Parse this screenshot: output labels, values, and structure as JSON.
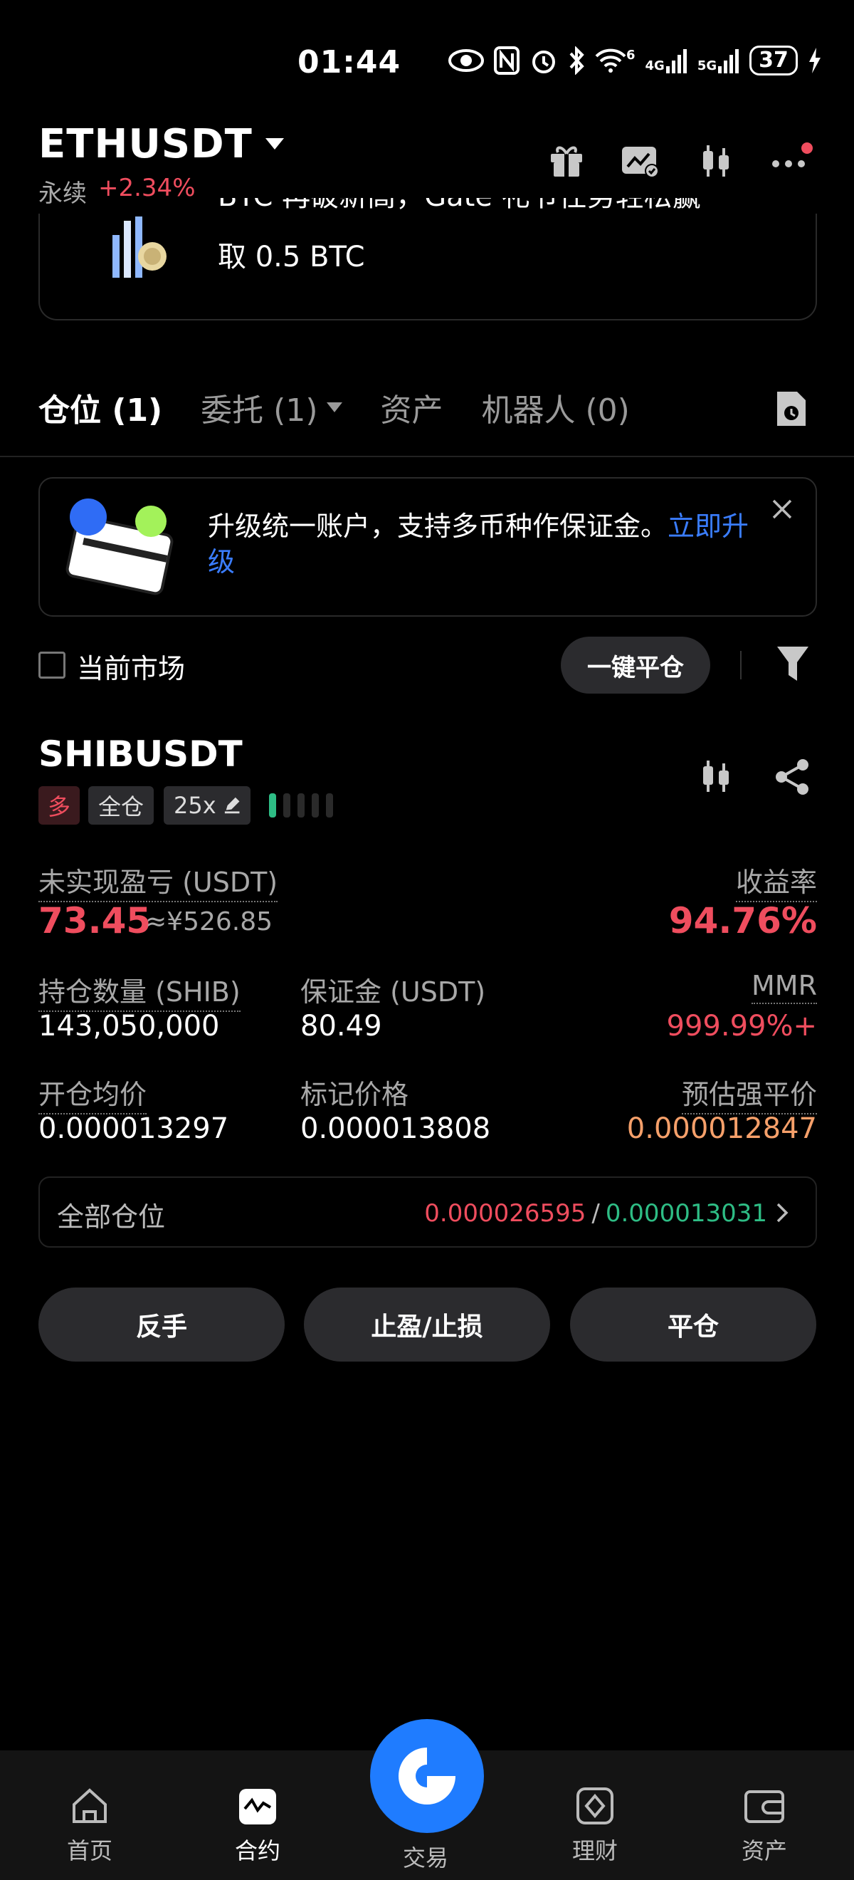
{
  "status_bar": {
    "time": "01:44",
    "battery": "37",
    "net1": "4G",
    "net2": "5G",
    "wifi_badge": "6"
  },
  "header": {
    "symbol": "ETHUSDT",
    "type": "永续",
    "change": "+2.34%"
  },
  "banner": {
    "line1": "BTC 再破新高，Gate 礼节任务轻松赢",
    "line2": "取 0.5 BTC"
  },
  "tabs": [
    {
      "label": "仓位",
      "count": "(1)"
    },
    {
      "label": "委托",
      "count": "(1)"
    },
    {
      "label": "资产",
      "count": ""
    },
    {
      "label": "机器人",
      "count": "(0)"
    }
  ],
  "promo": {
    "text": "升级统一账户，支持多币种作保证金。",
    "link": "立即升级"
  },
  "filter": {
    "current_market": "当前市场",
    "close_all": "一键平仓"
  },
  "position": {
    "symbol": "SHIBUSDT",
    "side": "多",
    "margin_mode": "全仓",
    "leverage": "25x",
    "unrealized_label": "未实现盈亏 (USDT)",
    "unrealized_value": "73.45",
    "unrealized_cny": "≈¥526.85",
    "roe_label": "收益率",
    "roe_value": "94.76%",
    "qty_label": "持仓数量 (SHIB)",
    "qty_value": "143,050,000",
    "margin_label": "保证金 (USDT)",
    "margin_value": "80.49",
    "mmr_label": "MMR",
    "mmr_value": "999.99%+",
    "entry_label": "开仓均价",
    "entry_value": "0.000013297",
    "mark_label": "标记价格",
    "mark_value": "0.000013808",
    "liq_label": "预估强平价",
    "liq_value": "0.000012847",
    "all_positions_label": "全部仓位",
    "all_positions_red": "0.000026595",
    "all_positions_sep": "/",
    "all_positions_green": "0.000013031"
  },
  "actions": {
    "reverse": "反手",
    "tpsl": "止盈/止损",
    "close": "平仓"
  },
  "bottom_nav": [
    {
      "label": "首页",
      "icon": "home-icon"
    },
    {
      "label": "合约",
      "icon": "futures-icon"
    },
    {
      "label": "交易",
      "icon": "trade-icon"
    },
    {
      "label": "理财",
      "icon": "earn-icon"
    },
    {
      "label": "资产",
      "icon": "wallet-icon"
    }
  ],
  "colors": {
    "accent": "#1f7cff",
    "up": "#ef4d5e",
    "down": "#2ebd85",
    "warning": "#f6a06a"
  }
}
